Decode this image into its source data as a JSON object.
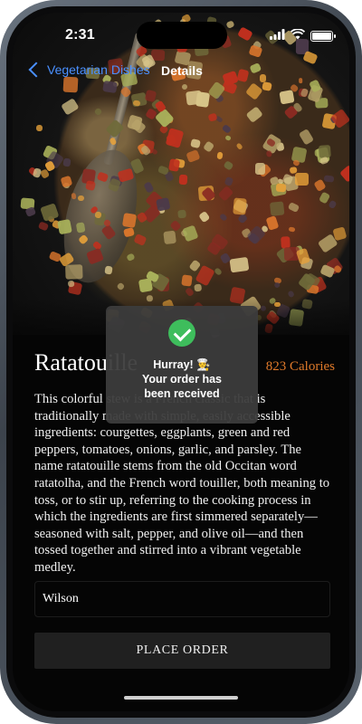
{
  "status_bar": {
    "time": "2:31"
  },
  "nav": {
    "back_label": "Vegetarian Dishes",
    "title": "Details"
  },
  "dish": {
    "title": "Ratatouille",
    "calories": "823 Calories",
    "description": "This colorful stew is a French classic that is traditionally made with simple, easily accessible ingredients: courgettes, eggplants, green and red peppers, tomatoes, onions, garlic, and parsley. The name ratatouille stems from the old Occitan word ratatolha, and the French word touiller, both meaning to toss, or to stir up, referring to the cooking process in which the ingredients are first simmered separately—seasoned with salt, pepper, and olive oil—and then tossed together and stirred into a vibrant vegetable medley."
  },
  "order_form": {
    "name_value": "Wilson",
    "place_order_label": "PLACE ORDER"
  },
  "toast": {
    "icon": "checkmark-circle-icon",
    "line1": "Hurray! 👨‍🍳",
    "line2": "Your order has",
    "line3": "been received"
  },
  "colors": {
    "accent": "#4a90ff",
    "calories": "#e07a2a",
    "success": "#3ebd5c"
  }
}
